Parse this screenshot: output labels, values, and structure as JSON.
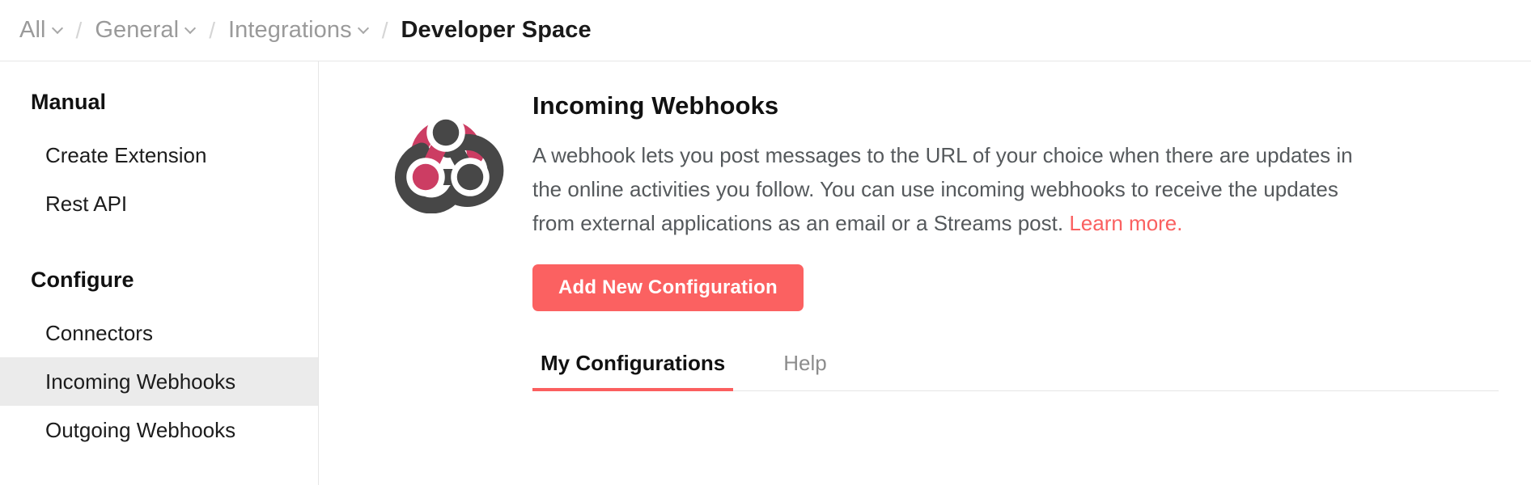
{
  "breadcrumb": {
    "separator": "/",
    "items": [
      {
        "label": "All",
        "has_caret": true,
        "current": false
      },
      {
        "label": "General",
        "has_caret": true,
        "current": false
      },
      {
        "label": "Integrations",
        "has_caret": true,
        "current": false
      },
      {
        "label": "Developer Space",
        "has_caret": false,
        "current": true
      }
    ]
  },
  "sidebar": {
    "sections": [
      {
        "heading": "Manual",
        "items": [
          {
            "label": "Create Extension",
            "active": false
          },
          {
            "label": "Rest API",
            "active": false
          }
        ]
      },
      {
        "heading": "Configure",
        "items": [
          {
            "label": "Connectors",
            "active": false
          },
          {
            "label": "Incoming Webhooks",
            "active": true
          },
          {
            "label": "Outgoing Webhooks",
            "active": false
          }
        ]
      }
    ]
  },
  "main": {
    "icon_name": "webhook-logo-icon",
    "title": "Incoming Webhooks",
    "description_before_link": "A webhook lets you post messages to the URL of your choice when there are updates in the online activities you follow. You can use incoming webhooks to receive the updates from external applications as an email or a Streams post. ",
    "link_label": "Learn more.",
    "primary_button": "Add New Configuration",
    "tabs": [
      {
        "label": "My Configurations",
        "active": true
      },
      {
        "label": "Help",
        "active": false
      }
    ]
  },
  "colors": {
    "accent_coral": "#fb6161",
    "link_coral": "#fa6060",
    "icon_pink": "#cc3d63",
    "icon_dark": "#474747",
    "sidebar_active_bg": "#ebebeb",
    "border": "#e6e6e6",
    "text_primary": "#111111",
    "text_muted": "#55595c",
    "breadcrumb_muted": "#9a9a9a"
  }
}
